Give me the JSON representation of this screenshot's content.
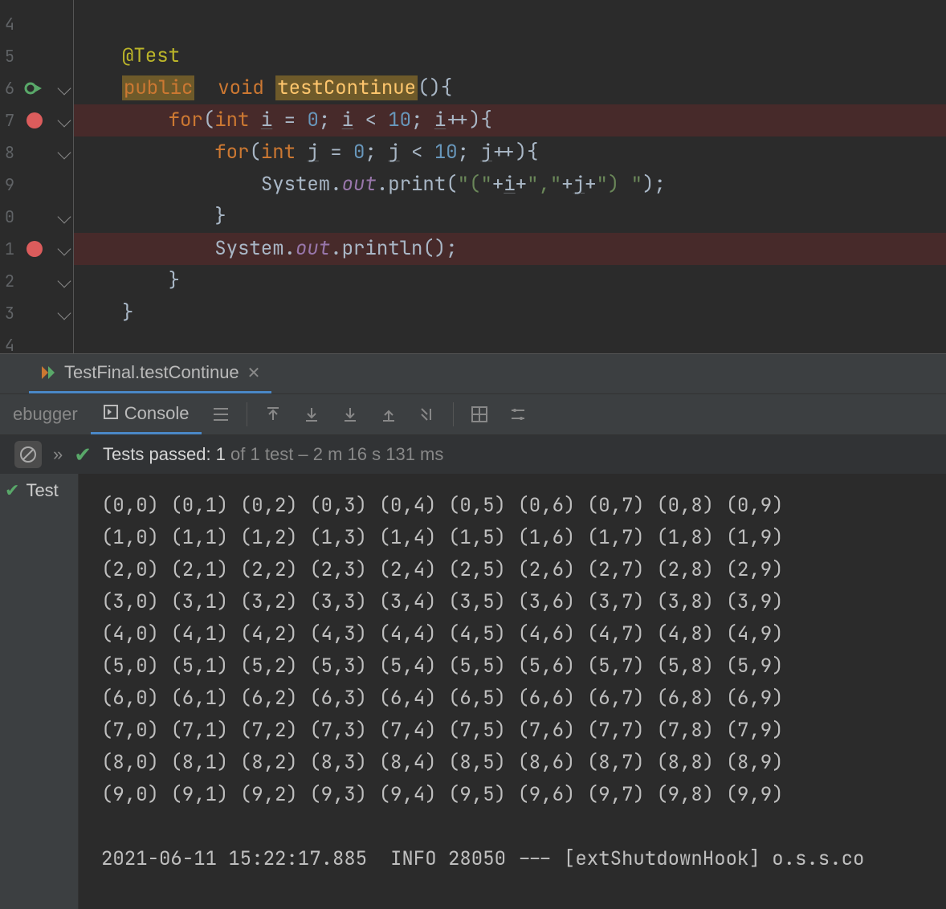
{
  "editor": {
    "lineNumbers": [
      "4",
      "5",
      "6",
      "7",
      "8",
      "9",
      "0",
      "1",
      "2",
      "3",
      "4"
    ],
    "breakpointLines": [
      3,
      7
    ],
    "runIconLine": 2,
    "foldLines": [
      2,
      3,
      4,
      6,
      7,
      8,
      9
    ],
    "code": {
      "annotation": "@Test",
      "public": "public",
      "void": "void",
      "methodName": "testContinue",
      "ln3": {
        "for": "for",
        "int": "int",
        "i": "i",
        "eq": " = ",
        "zero": "0",
        "semi": "; ",
        "lt": " < ",
        "ten": "10",
        "inc": "++"
      },
      "ln4": {
        "for": "for",
        "int": "int",
        "j": "j",
        "eq": " = ",
        "zero": "0",
        "semi": "; ",
        "lt": " < ",
        "ten": "10",
        "inc": "++"
      },
      "ln5": {
        "sys": "System.",
        "out": "out",
        "print": ".print(",
        "s1": "\"(\"",
        "plus": "+",
        "i": "i",
        "s2": "\",\"",
        "j": "j",
        "s3": "\") \"",
        "end": ");"
      },
      "ln6": "}",
      "ln7": {
        "sys": "System.",
        "out": "out",
        "println": ".println();"
      },
      "ln8": "}",
      "ln9": "}"
    }
  },
  "tab": {
    "label": "TestFinal.testContinue"
  },
  "toolbar": {
    "debugger": "ebugger",
    "console": "Console"
  },
  "status": {
    "passedLabel": "Tests passed: 1",
    "ofLabel": " of 1 test – 2 m 16 s 131 ms"
  },
  "tree": {
    "item": "Test "
  },
  "console": {
    "rows": 10,
    "cols": 10,
    "tail": "2021-06-11 15:22:17.885  INFO 28050 --- [extShutdownHook] o.s.s.co"
  }
}
